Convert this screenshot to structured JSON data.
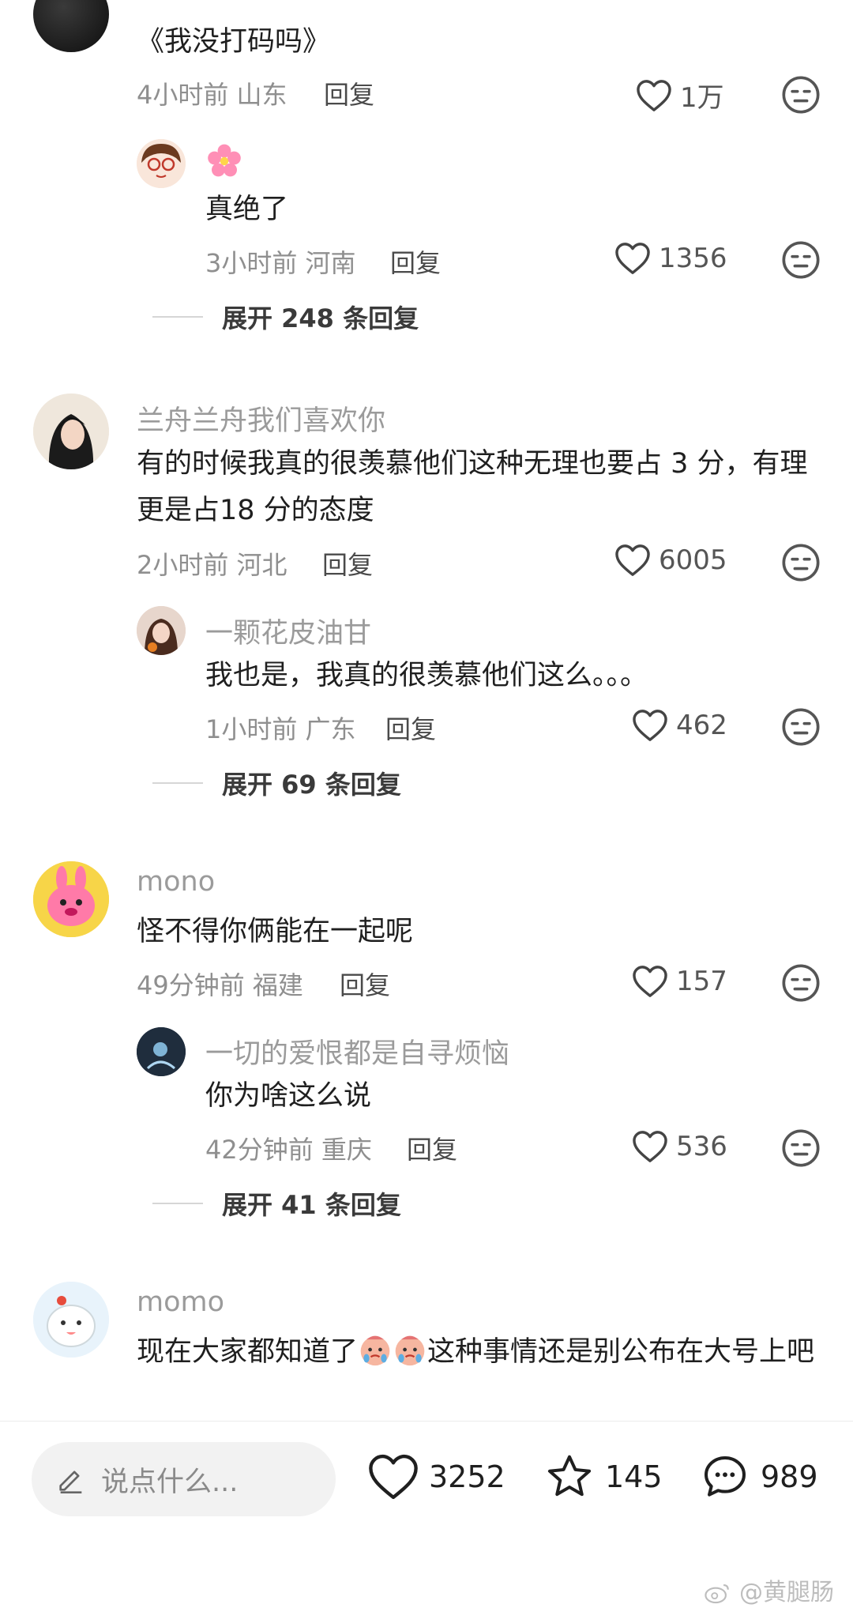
{
  "comments": [
    {
      "name": "",
      "text": "《我没打码吗》",
      "time": "4小时前",
      "location": "山东",
      "reply_label": "回复",
      "likes": "1万",
      "reply": {
        "name": "",
        "text": "真绝了",
        "time": "3小时前",
        "location": "河南",
        "reply_label": "回复",
        "likes": "1356"
      },
      "expand": "展开 248 条回复"
    },
    {
      "name": "兰舟兰舟我们喜欢你",
      "text": "有的时候我真的很羡慕他们这种无理也要占 3 分，有理更是占18 分的态度",
      "time": "2小时前",
      "location": "河北",
      "reply_label": "回复",
      "likes": "6005",
      "reply": {
        "name": "一颗花皮油甘",
        "text": "我也是，我真的很羡慕他们这么。。。",
        "time": "1小时前",
        "location": "广东",
        "reply_label": "回复",
        "likes": "462"
      },
      "expand": "展开 69 条回复"
    },
    {
      "name": "mono",
      "text": "怪不得你俩能在一起呢",
      "time": "49分钟前",
      "location": "福建",
      "reply_label": "回复",
      "likes": "157",
      "reply": {
        "name": "一切的爱恨都是自寻烦恼",
        "text": "你为啥这么说",
        "time": "42分钟前",
        "location": "重庆",
        "reply_label": "回复",
        "likes": "536"
      },
      "expand": "展开 41 条回复"
    },
    {
      "name": "momo",
      "text_before": "现在大家都知道了",
      "text_after": "这种事情还是别公布在大号上吧"
    }
  ],
  "bottom_bar": {
    "input_placeholder": "说点什么...",
    "likes": "3252",
    "favorites": "145",
    "comments": "989"
  },
  "watermark": "@黄腿肠",
  "colors": {
    "muted": "#9b9b9b",
    "text": "#1f1f1f",
    "avatar_pink": "#ff7aa8",
    "avatar_yellow": "#f7d548",
    "blossom": "#ff8fb6"
  }
}
